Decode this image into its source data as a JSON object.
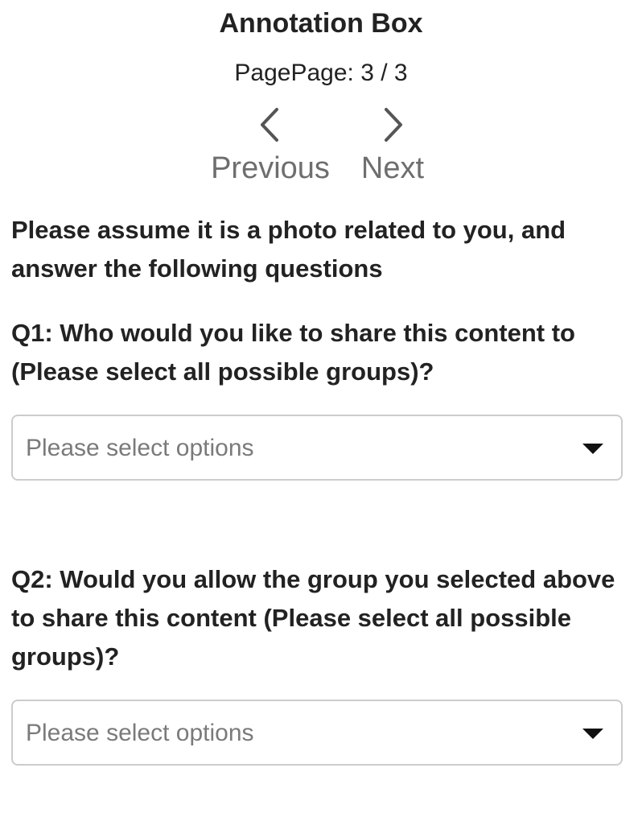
{
  "header": {
    "title": "Annotation Box",
    "page_indicator": "PagePage: 3 / 3"
  },
  "nav": {
    "previous_label": "Previous",
    "next_label": "Next",
    "previous_icon": "chevron-left-icon",
    "next_icon": "chevron-right-icon"
  },
  "instruction": "Please assume it is a photo related to you, and answer the following questions",
  "questions": [
    {
      "text": "Q1: Who would you like to share this content to (Please select all possible groups)?",
      "select_placeholder": "Please select options"
    },
    {
      "text": "Q2: Would you allow the group you selected above to share this content (Please select all possible groups)?",
      "select_placeholder": "Please select options"
    }
  ],
  "colors": {
    "text": "#222222",
    "nav_text": "#6e6e6e",
    "placeholder": "#7a7a7a",
    "border": "#cccccc"
  }
}
